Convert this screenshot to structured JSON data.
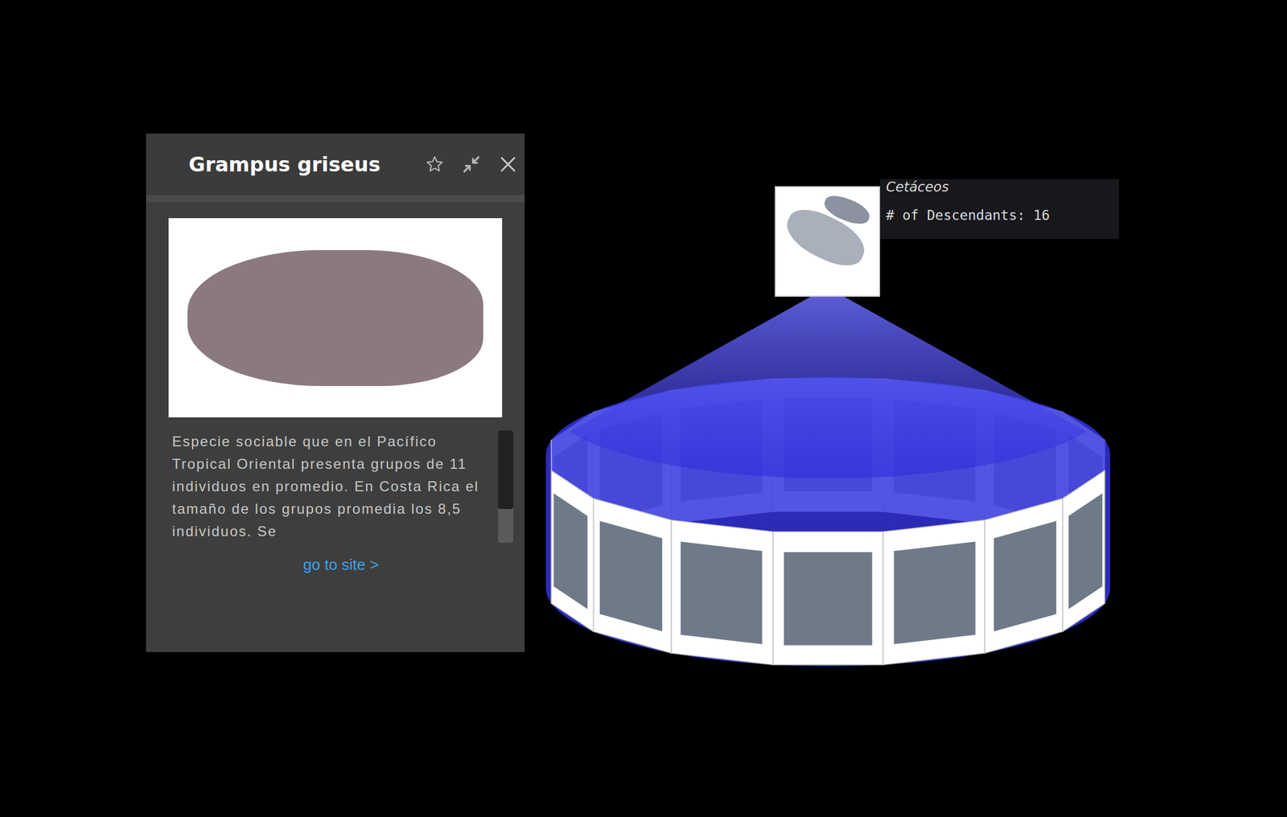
{
  "info_panel": {
    "title": "Grampus griseus",
    "favorite": false,
    "description": "Especie sociable que en el Pacífico Tropical Oriental presenta grupos de 11 individuos en promedio. En Costa Rica el tamaño de los grupos promedia los 8,5 individuos. Se",
    "scrollbar": {
      "level": 0.7
    },
    "link": "go to site >"
  },
  "tooltip": {
    "title": "Cetáceos",
    "descendants": "# of Descendants: 16"
  }
}
